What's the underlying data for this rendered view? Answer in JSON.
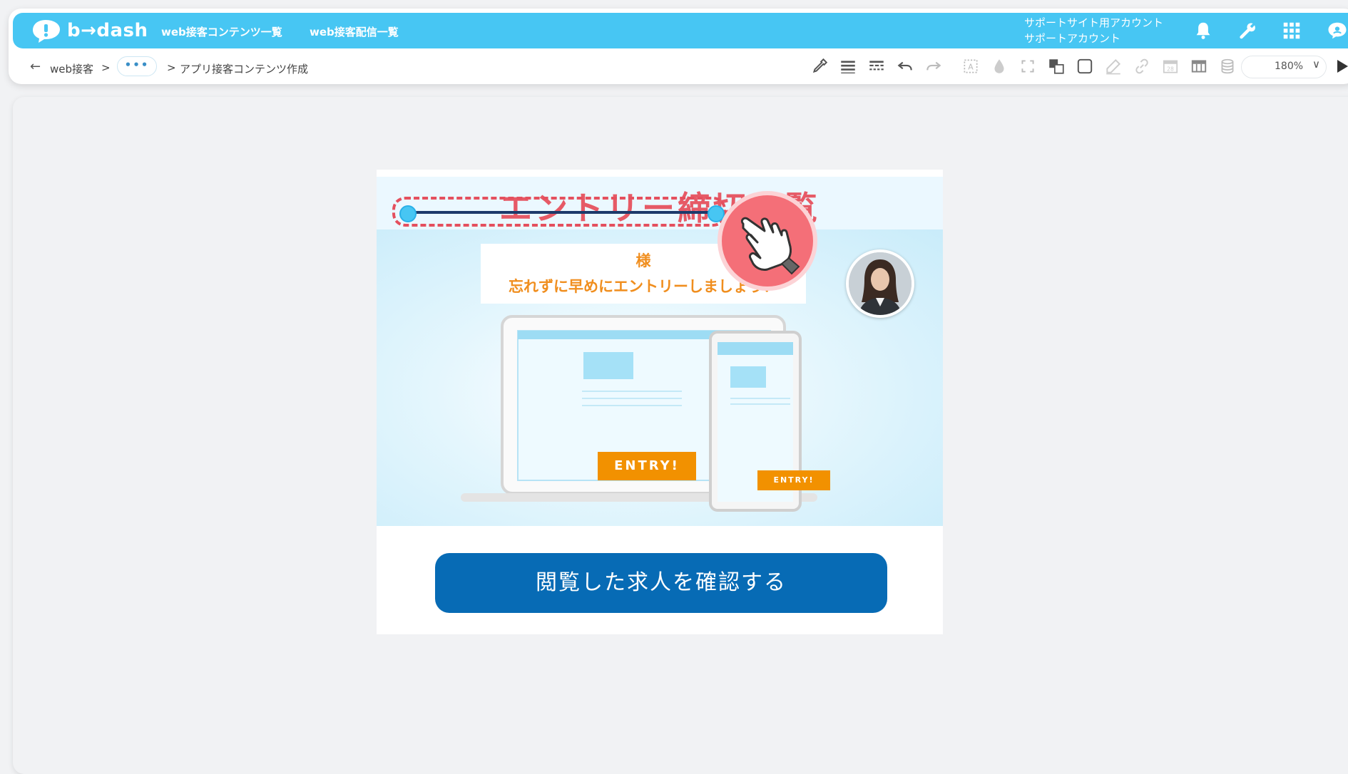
{
  "app": {
    "logo_text": "b→dash",
    "nav": [
      "web接客コンテンツ一覧",
      "web接客配信一覧"
    ],
    "account_line1": "サポートサイト用アカウント",
    "account_line2": "サポートアカウント"
  },
  "top_icons": [
    "bell-icon",
    "wrench-icon",
    "apps-grid-icon",
    "user-chat-icon"
  ],
  "breadcrumb": {
    "back": "←",
    "root": "web接客",
    "sep1": ">",
    "ellipsis": "•••",
    "sep2": ">",
    "current": "アプリ接客コンテンツ作成"
  },
  "toolbar": {
    "tools": [
      "eyedropper-icon",
      "align-rows-icon",
      "align-dashed-rows-icon",
      "undo-icon",
      "redo-icon",
      "text-frame-icon",
      "drop-icon",
      "expand-icon",
      "layers-icon",
      "square-icon",
      "pen-icon",
      "link-icon",
      "calendar-icon",
      "table-icon",
      "database-icon"
    ],
    "zoom": "180%",
    "zoom_chevron": "∨"
  },
  "preview": {
    "title": "エントリー締切一覧",
    "message_name": "様",
    "message_body": "忘れずに早めにエントリーしましょう！",
    "entry_label_large": "ENTRY!",
    "entry_label_small": "ENTRY!",
    "cta_label": "閲覧した求人を確認する"
  },
  "colors": {
    "brand": "#47c6f3",
    "cta": "#076bb5",
    "title": "#e65a66",
    "orange": "#f08e1e"
  }
}
